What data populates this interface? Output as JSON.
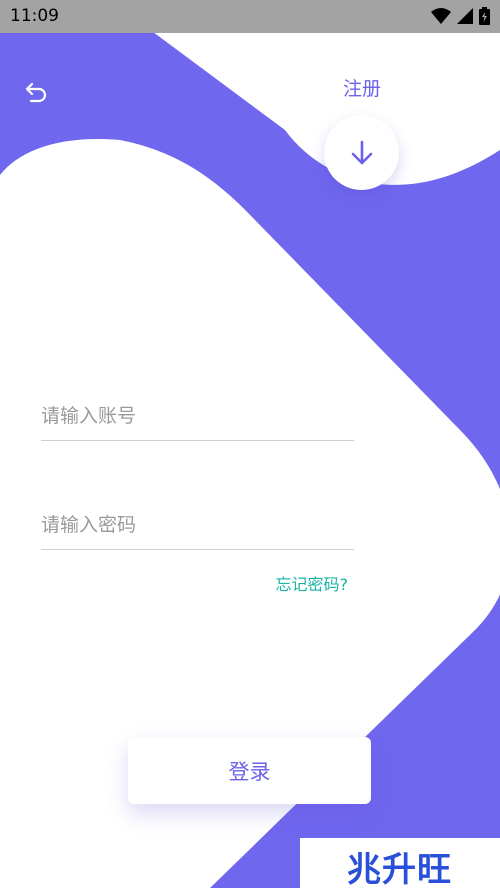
{
  "status_bar": {
    "time": "11:09",
    "icons": [
      "wifi-icon",
      "cellular-signal-icon",
      "battery-icon"
    ]
  },
  "header": {
    "back_icon": "undo-arrow-icon",
    "register_label": "注册",
    "down_icon": "arrow-down-icon"
  },
  "form": {
    "account_placeholder": "请输入账号",
    "account_value": "",
    "password_placeholder": "请输入密码",
    "password_value": "",
    "forgot_label": "忘记密码?"
  },
  "login_label": "登录",
  "watermark_text": "兆升旺",
  "colors": {
    "accent": "#7067ef",
    "accent_text": "#6c62e8",
    "link": "#19b3a6",
    "status_bar": "#a3a3a3",
    "background": "#ffffff"
  }
}
